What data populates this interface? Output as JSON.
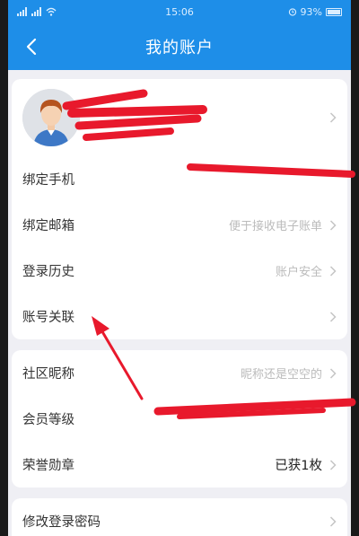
{
  "status": {
    "time": "15:06",
    "battery": "93%"
  },
  "header": {
    "title": "我的账户"
  },
  "rows_group1": [
    {
      "label": "绑定手机",
      "value": ""
    },
    {
      "label": "绑定邮箱",
      "value": "便于接收电子账单"
    },
    {
      "label": "登录历史",
      "value": "账户安全"
    },
    {
      "label": "账号关联",
      "value": ""
    }
  ],
  "rows_group2": [
    {
      "label": "社区昵称",
      "value": "昵称还是空空的"
    },
    {
      "label": "会员等级",
      "value": ""
    },
    {
      "label": "荣誉勋章",
      "value": "已获1枚"
    }
  ],
  "rows_group3": [
    {
      "label": "修改登录密码",
      "value": ""
    }
  ],
  "colors": {
    "accent": "#1e8ee8",
    "annotation": "#e8192c"
  }
}
